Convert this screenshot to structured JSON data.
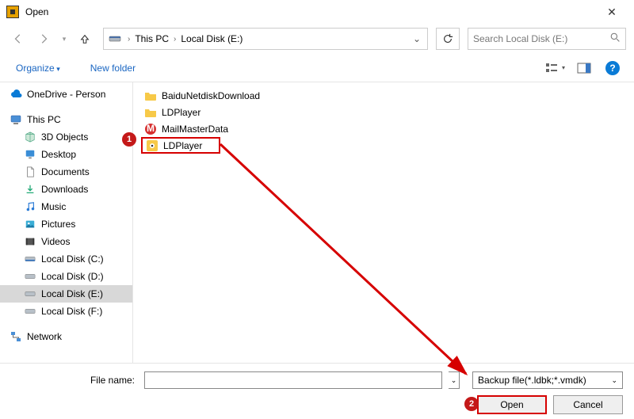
{
  "title": "Open",
  "breadcrumb": {
    "root_icon": "pc",
    "items": [
      "This PC",
      "Local Disk (E:)"
    ]
  },
  "search": {
    "placeholder": "Search Local Disk (E:)"
  },
  "toolbar": {
    "organize": "Organize",
    "new_folder": "New folder"
  },
  "tree": {
    "onedrive": "OneDrive - Person",
    "thispc": "This PC",
    "children": [
      "3D Objects",
      "Desktop",
      "Documents",
      "Downloads",
      "Music",
      "Pictures",
      "Videos",
      "Local Disk (C:)",
      "Local Disk (D:)",
      "Local Disk (E:)",
      "Local Disk (F:)"
    ],
    "selected": "Local Disk (E:)",
    "network": "Network"
  },
  "files": [
    {
      "name": "BaiduNetdiskDownload",
      "type": "folder"
    },
    {
      "name": "LDPlayer",
      "type": "folder"
    },
    {
      "name": "MailMasterData",
      "type": "app-red"
    },
    {
      "name": "LDPlayer",
      "type": "app-yellow",
      "highlighted": true
    }
  ],
  "callouts": {
    "1": "1",
    "2": "2"
  },
  "bottom": {
    "filename_label": "File name:",
    "filename_value": "",
    "filter": "Backup file(*.ldbk;*.vmdk)",
    "open": "Open",
    "cancel": "Cancel"
  }
}
